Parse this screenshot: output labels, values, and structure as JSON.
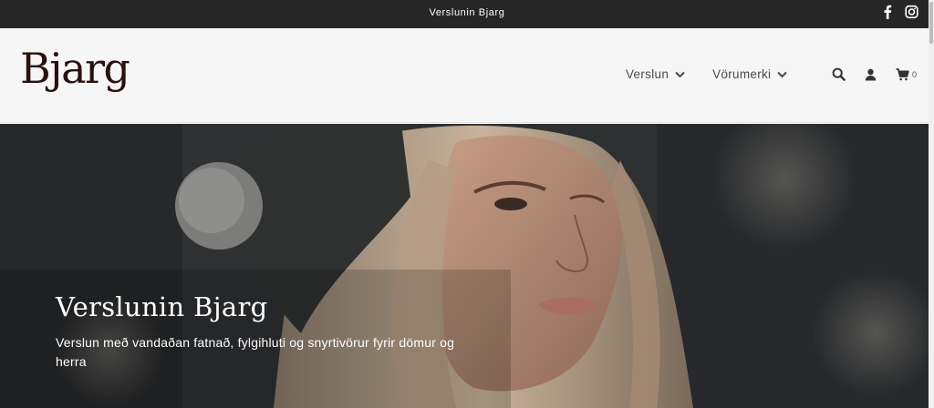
{
  "announcement": {
    "text": "Verslunin Bjarg"
  },
  "social": {
    "icons": [
      "facebook-icon",
      "instagram-icon"
    ]
  },
  "header": {
    "logo_text": "Bjarg",
    "nav": [
      {
        "label": "Verslun",
        "icon": "chevron-down-icon"
      },
      {
        "label": "Vörumerki",
        "icon": "chevron-down-icon"
      }
    ],
    "icons": [
      "search-icon",
      "user-icon",
      "cart-icon"
    ],
    "cart_count": "0"
  },
  "hero": {
    "title": "Verslunin Bjarg",
    "subtitle": "Verslun með vandaðan fatnað, fylgihluti og snyrtivörur fyrir dömur og herra"
  },
  "colors": {
    "topbar_bg": "#262626",
    "header_bg": "#f6f6f6",
    "logo": "#2a1010",
    "hero_text": "#ffffff"
  }
}
